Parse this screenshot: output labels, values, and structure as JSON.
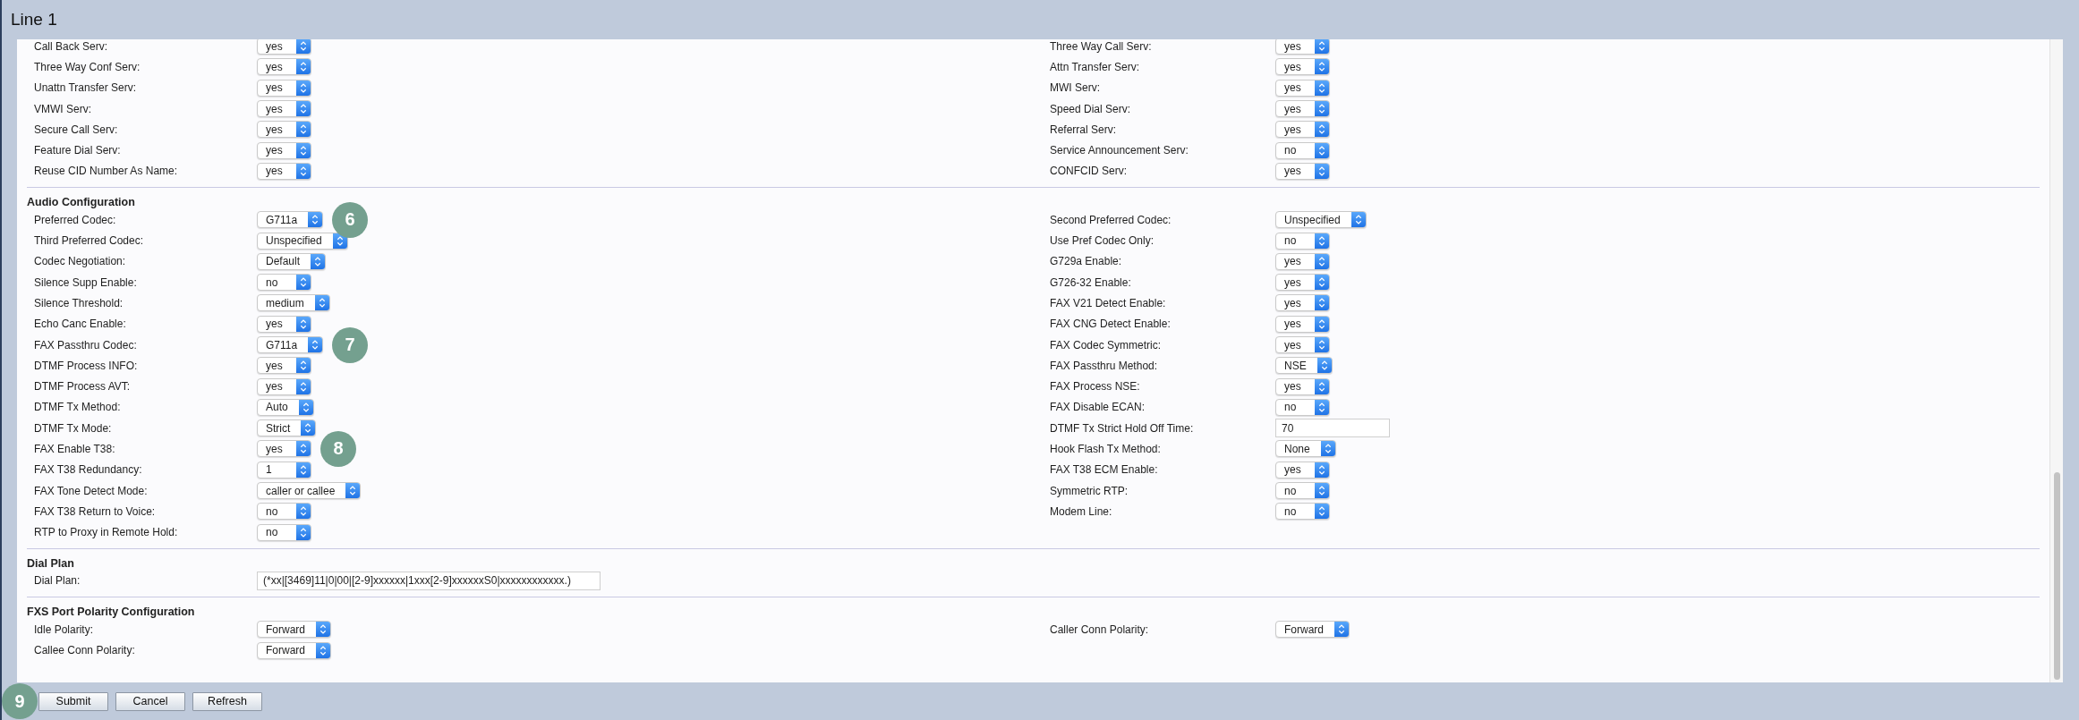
{
  "window": {
    "title": "Line 1"
  },
  "sections": [
    {
      "rows": [
        {
          "left": {
            "label": "Call Back Serv:",
            "kind": "select",
            "value": "yes"
          },
          "right": {
            "label": "Three Way Call Serv:",
            "kind": "select",
            "value": "yes"
          }
        },
        {
          "left": {
            "label": "Three Way Conf Serv:",
            "kind": "select",
            "value": "yes"
          },
          "right": {
            "label": "Attn Transfer Serv:",
            "kind": "select",
            "value": "yes"
          }
        },
        {
          "left": {
            "label": "Unattn Transfer Serv:",
            "kind": "select",
            "value": "yes"
          },
          "right": {
            "label": "MWI Serv:",
            "kind": "select",
            "value": "yes"
          }
        },
        {
          "left": {
            "label": "VMWI Serv:",
            "kind": "select",
            "value": "yes"
          },
          "right": {
            "label": "Speed Dial Serv:",
            "kind": "select",
            "value": "yes"
          }
        },
        {
          "left": {
            "label": "Secure Call Serv:",
            "kind": "select",
            "value": "yes"
          },
          "right": {
            "label": "Referral Serv:",
            "kind": "select",
            "value": "yes"
          }
        },
        {
          "left": {
            "label": "Feature Dial Serv:",
            "kind": "select",
            "value": "yes"
          },
          "right": {
            "label": "Service Announcement Serv:",
            "kind": "select",
            "value": "no"
          }
        },
        {
          "left": {
            "label": "Reuse CID Number As Name:",
            "kind": "select",
            "value": "yes"
          },
          "right": {
            "label": "CONFCID Serv:",
            "kind": "select",
            "value": "yes"
          }
        }
      ]
    },
    {
      "title": "Audio Configuration",
      "rows": [
        {
          "left": {
            "label": "Preferred Codec:",
            "kind": "select",
            "value": "G711a",
            "callout": "6"
          },
          "right": {
            "label": "Second Preferred Codec:",
            "kind": "select",
            "value": "Unspecified"
          }
        },
        {
          "left": {
            "label": "Third Preferred Codec:",
            "kind": "select",
            "value": "Unspecified"
          },
          "right": {
            "label": "Use Pref Codec Only:",
            "kind": "select",
            "value": "no"
          }
        },
        {
          "left": {
            "label": "Codec Negotiation:",
            "kind": "select",
            "value": "Default"
          },
          "right": {
            "label": "G729a Enable:",
            "kind": "select",
            "value": "yes"
          }
        },
        {
          "left": {
            "label": "Silence Supp Enable:",
            "kind": "select",
            "value": "no"
          },
          "right": {
            "label": "G726-32 Enable:",
            "kind": "select",
            "value": "yes"
          }
        },
        {
          "left": {
            "label": "Silence Threshold:",
            "kind": "select",
            "value": "medium"
          },
          "right": {
            "label": "FAX V21 Detect Enable:",
            "kind": "select",
            "value": "yes"
          }
        },
        {
          "left": {
            "label": "Echo Canc Enable:",
            "kind": "select",
            "value": "yes"
          },
          "right": {
            "label": "FAX CNG Detect Enable:",
            "kind": "select",
            "value": "yes"
          }
        },
        {
          "left": {
            "label": "FAX Passthru Codec:",
            "kind": "select",
            "value": "G711a",
            "callout": "7"
          },
          "right": {
            "label": "FAX Codec Symmetric:",
            "kind": "select",
            "value": "yes"
          }
        },
        {
          "left": {
            "label": "DTMF Process INFO:",
            "kind": "select",
            "value": "yes"
          },
          "right": {
            "label": "FAX Passthru Method:",
            "kind": "select",
            "value": "NSE"
          }
        },
        {
          "left": {
            "label": "DTMF Process AVT:",
            "kind": "select",
            "value": "yes"
          },
          "right": {
            "label": "FAX Process NSE:",
            "kind": "select",
            "value": "yes"
          }
        },
        {
          "left": {
            "label": "DTMF Tx Method:",
            "kind": "select",
            "value": "Auto"
          },
          "right": {
            "label": "FAX Disable ECAN:",
            "kind": "select",
            "value": "no"
          }
        },
        {
          "left": {
            "label": "DTMF Tx Mode:",
            "kind": "select",
            "value": "Strict"
          },
          "right": {
            "label": "DTMF Tx Strict Hold Off Time:",
            "kind": "text",
            "value": "70"
          }
        },
        {
          "left": {
            "label": "FAX Enable T38:",
            "kind": "select",
            "value": "yes",
            "callout": "8"
          },
          "right": {
            "label": "Hook Flash Tx Method:",
            "kind": "select",
            "value": "None"
          }
        },
        {
          "left": {
            "label": "FAX T38 Redundancy:",
            "kind": "select",
            "value": "1"
          },
          "right": {
            "label": "FAX T38 ECM Enable:",
            "kind": "select",
            "value": "yes"
          }
        },
        {
          "left": {
            "label": "FAX Tone Detect Mode:",
            "kind": "select",
            "value": "caller or callee"
          },
          "right": {
            "label": "Symmetric RTP:",
            "kind": "select",
            "value": "no"
          }
        },
        {
          "left": {
            "label": "FAX T38 Return to Voice:",
            "kind": "select",
            "value": "no"
          },
          "right": {
            "label": "Modem Line:",
            "kind": "select",
            "value": "no"
          }
        },
        {
          "left": {
            "label": "RTP to Proxy in Remote Hold:",
            "kind": "select",
            "value": "no"
          }
        }
      ]
    },
    {
      "title": "Dial Plan",
      "rows": [
        {
          "left": {
            "label": "Dial Plan:",
            "kind": "text",
            "value": "(*xx|[3469]11|0|00|[2-9]xxxxxx|1xxx[2-9]xxxxxxS0|xxxxxxxxxxxx.)"
          }
        }
      ]
    },
    {
      "title": "FXS Port Polarity Configuration",
      "rows": [
        {
          "left": {
            "label": "Idle Polarity:",
            "kind": "select",
            "value": "Forward"
          },
          "right": {
            "label": "Caller Conn Polarity:",
            "kind": "select",
            "value": "Forward"
          }
        },
        {
          "left": {
            "label": "Callee Conn Polarity:",
            "kind": "select",
            "value": "Forward"
          }
        }
      ]
    }
  ],
  "buttons": [
    {
      "label": "Submit",
      "callout": "9"
    },
    {
      "label": "Cancel"
    },
    {
      "label": "Refresh"
    }
  ]
}
